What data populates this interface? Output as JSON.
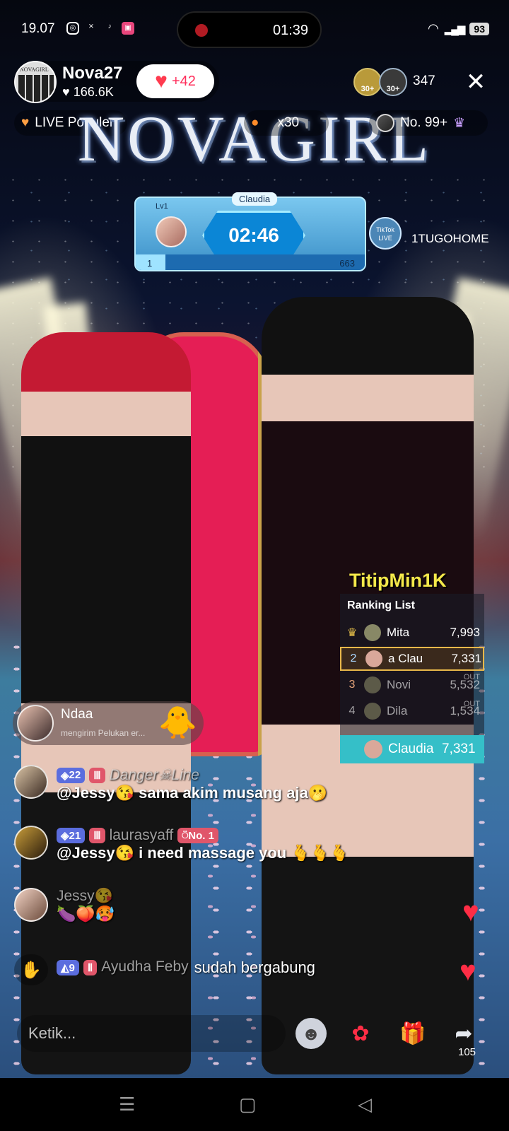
{
  "status_bar": {
    "time": "19.07",
    "recording_time": "01:39",
    "battery": "93",
    "icons": [
      "instagram-icon",
      "capcut-icon",
      "tiktok-icon",
      "app-icon"
    ]
  },
  "host": {
    "avatar_text": "NOVAGIRL",
    "name": "Nova27",
    "likes": "166.6K",
    "follow_label": "+42"
  },
  "viewers": {
    "badge1": "30+",
    "badge2": "30+",
    "count": "347"
  },
  "chips": {
    "live_popular": "LIVE Populer",
    "multiplier": "x30",
    "rank": "No. 99+"
  },
  "banner_title": "NOVAGIRL",
  "timer_widget": {
    "level": "Lv1",
    "name": "Claudia",
    "time": "02:46",
    "progress_left": "1",
    "progress_right": "663",
    "progress_fraction": 0.13
  },
  "partner_label": "1TUGOHOME",
  "partner_badge": "TikTok LIVE",
  "titip_label": "TitipMin1K",
  "ranking": {
    "title": "Ranking List",
    "rows": [
      {
        "rank": "♛",
        "name": "Mita",
        "score": "7,993"
      },
      {
        "rank": "2",
        "name": "a  Clau",
        "score": "7,331"
      },
      {
        "rank": "3",
        "name": "Novi",
        "score": "5,532"
      },
      {
        "rank": "4",
        "name": "Dila",
        "score": "1,534"
      }
    ],
    "out_label": "OUT",
    "me": {
      "name": "Claudia",
      "score": "7,331"
    }
  },
  "gift_notice": {
    "user": "Ndaa",
    "text": "mengirim Pelukan er..."
  },
  "chat": [
    {
      "level": "22",
      "user": "Danger☠Line",
      "text": "@Jessy😘 sama akim musang aja🫢"
    },
    {
      "level": "21",
      "user": "laurasyaff",
      "rank_badge": "No. 1",
      "text": "@Jessy😘 i need massage you 🫰🫰🫰"
    },
    {
      "user": "Jessy😘",
      "text": "🍆🍑🥵"
    },
    {
      "level": "9",
      "user": "Ayudha Feby",
      "text": "sudah bergabung"
    }
  ],
  "bottom_bar": {
    "input_placeholder": "Ketik...",
    "share_count": "105"
  },
  "colors": {
    "accent_pink": "#ff2e5b",
    "rank_highlight": "#35bfc8",
    "titip_yellow": "#f5e94a"
  }
}
